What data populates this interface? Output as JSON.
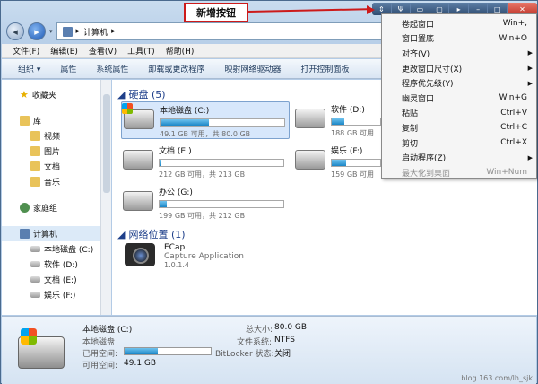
{
  "callout": {
    "label": "新增按钮"
  },
  "caption_buttons": [
    "pin-icon",
    "tool-icon",
    "minimize-tray-icon",
    "window-icon",
    "arrow-icon",
    "minimize-icon",
    "maximize-icon",
    "close-icon"
  ],
  "address": {
    "path_root": "▸",
    "path_label": "计算机",
    "separator": "▸"
  },
  "menubar": {
    "items": [
      "文件(F)",
      "编辑(E)",
      "查看(V)",
      "工具(T)",
      "帮助(H)"
    ]
  },
  "toolbar": {
    "items": [
      "组织 ▾",
      "属性",
      "系统属性",
      "卸载或更改程序",
      "映射网络驱动器",
      "打开控制面板"
    ]
  },
  "sidebar": {
    "favorites": "收藏夹",
    "library": "库",
    "library_items": [
      "视频",
      "图片",
      "文档",
      "音乐"
    ],
    "homegroup": "家庭组",
    "computer": "计算机",
    "drives": [
      "本地磁盘 (C:)",
      "软件 (D:)",
      "文档 (E:)",
      "娱乐 (F:)"
    ]
  },
  "content": {
    "disks_header": "硬盘 (5)",
    "drives": [
      {
        "name": "本地磁盘 (C:)",
        "size": "49.1 GB 可用，共 80.0 GB",
        "used": 0.39
      },
      {
        "name": "软件 (D:)",
        "size": "188 GB 可用",
        "used": 0.25
      },
      {
        "name": "文档 (E:)",
        "size": "212 GB 可用，共 213 GB",
        "used": 0.01
      },
      {
        "name": "娱乐 (F:)",
        "size": "159 GB 可用",
        "used": 0.3
      },
      {
        "name": "办公 (G:)",
        "size": "199 GB 可用，共 212 GB",
        "used": 0.06
      }
    ],
    "network_header": "网络位置 (1)",
    "network_item": {
      "name": "ECap",
      "desc": "Capture Application",
      "version": "1.0.1.4"
    }
  },
  "status": {
    "name": "本地磁盘 (C:)",
    "type": "本地磁盘",
    "used_label": "已用空间:",
    "free_label": "可用空间:",
    "free_value": "49.1 GB",
    "total_label": "总大小:",
    "total_value": "80.0 GB",
    "fs_label": "文件系统:",
    "fs_value": "NTFS",
    "bitlocker_label": "BitLocker 状态:",
    "bitlocker_value": "关闭",
    "used_fraction": 0.39
  },
  "watermark": "blog.163.com/lh_sjk",
  "context_menu": {
    "items": [
      {
        "label": "卷起窗口",
        "shortcut": "Win+,",
        "submenu": false,
        "disabled": false
      },
      {
        "label": "窗口置底",
        "shortcut": "Win+O",
        "submenu": false,
        "disabled": false
      },
      {
        "label": "对齐(V)",
        "shortcut": "",
        "submenu": true,
        "disabled": false
      },
      {
        "label": "更改窗口尺寸(X)",
        "shortcut": "",
        "submenu": true,
        "disabled": false
      },
      {
        "label": "程序优先级(Y)",
        "shortcut": "",
        "submenu": true,
        "disabled": false
      },
      {
        "label": "幽灵窗口",
        "shortcut": "Win+G",
        "submenu": false,
        "disabled": false
      },
      {
        "label": "粘贴",
        "shortcut": "Ctrl+V",
        "submenu": false,
        "disabled": false
      },
      {
        "label": "复制",
        "shortcut": "Ctrl+C",
        "submenu": false,
        "disabled": false
      },
      {
        "label": "剪切",
        "shortcut": "Ctrl+X",
        "submenu": false,
        "disabled": false
      },
      {
        "label": "启动程序(Z)",
        "shortcut": "",
        "submenu": true,
        "disabled": false
      },
      {
        "label": "最大化到桌面",
        "shortcut": "Win+Num",
        "submenu": false,
        "disabled": true
      }
    ]
  }
}
